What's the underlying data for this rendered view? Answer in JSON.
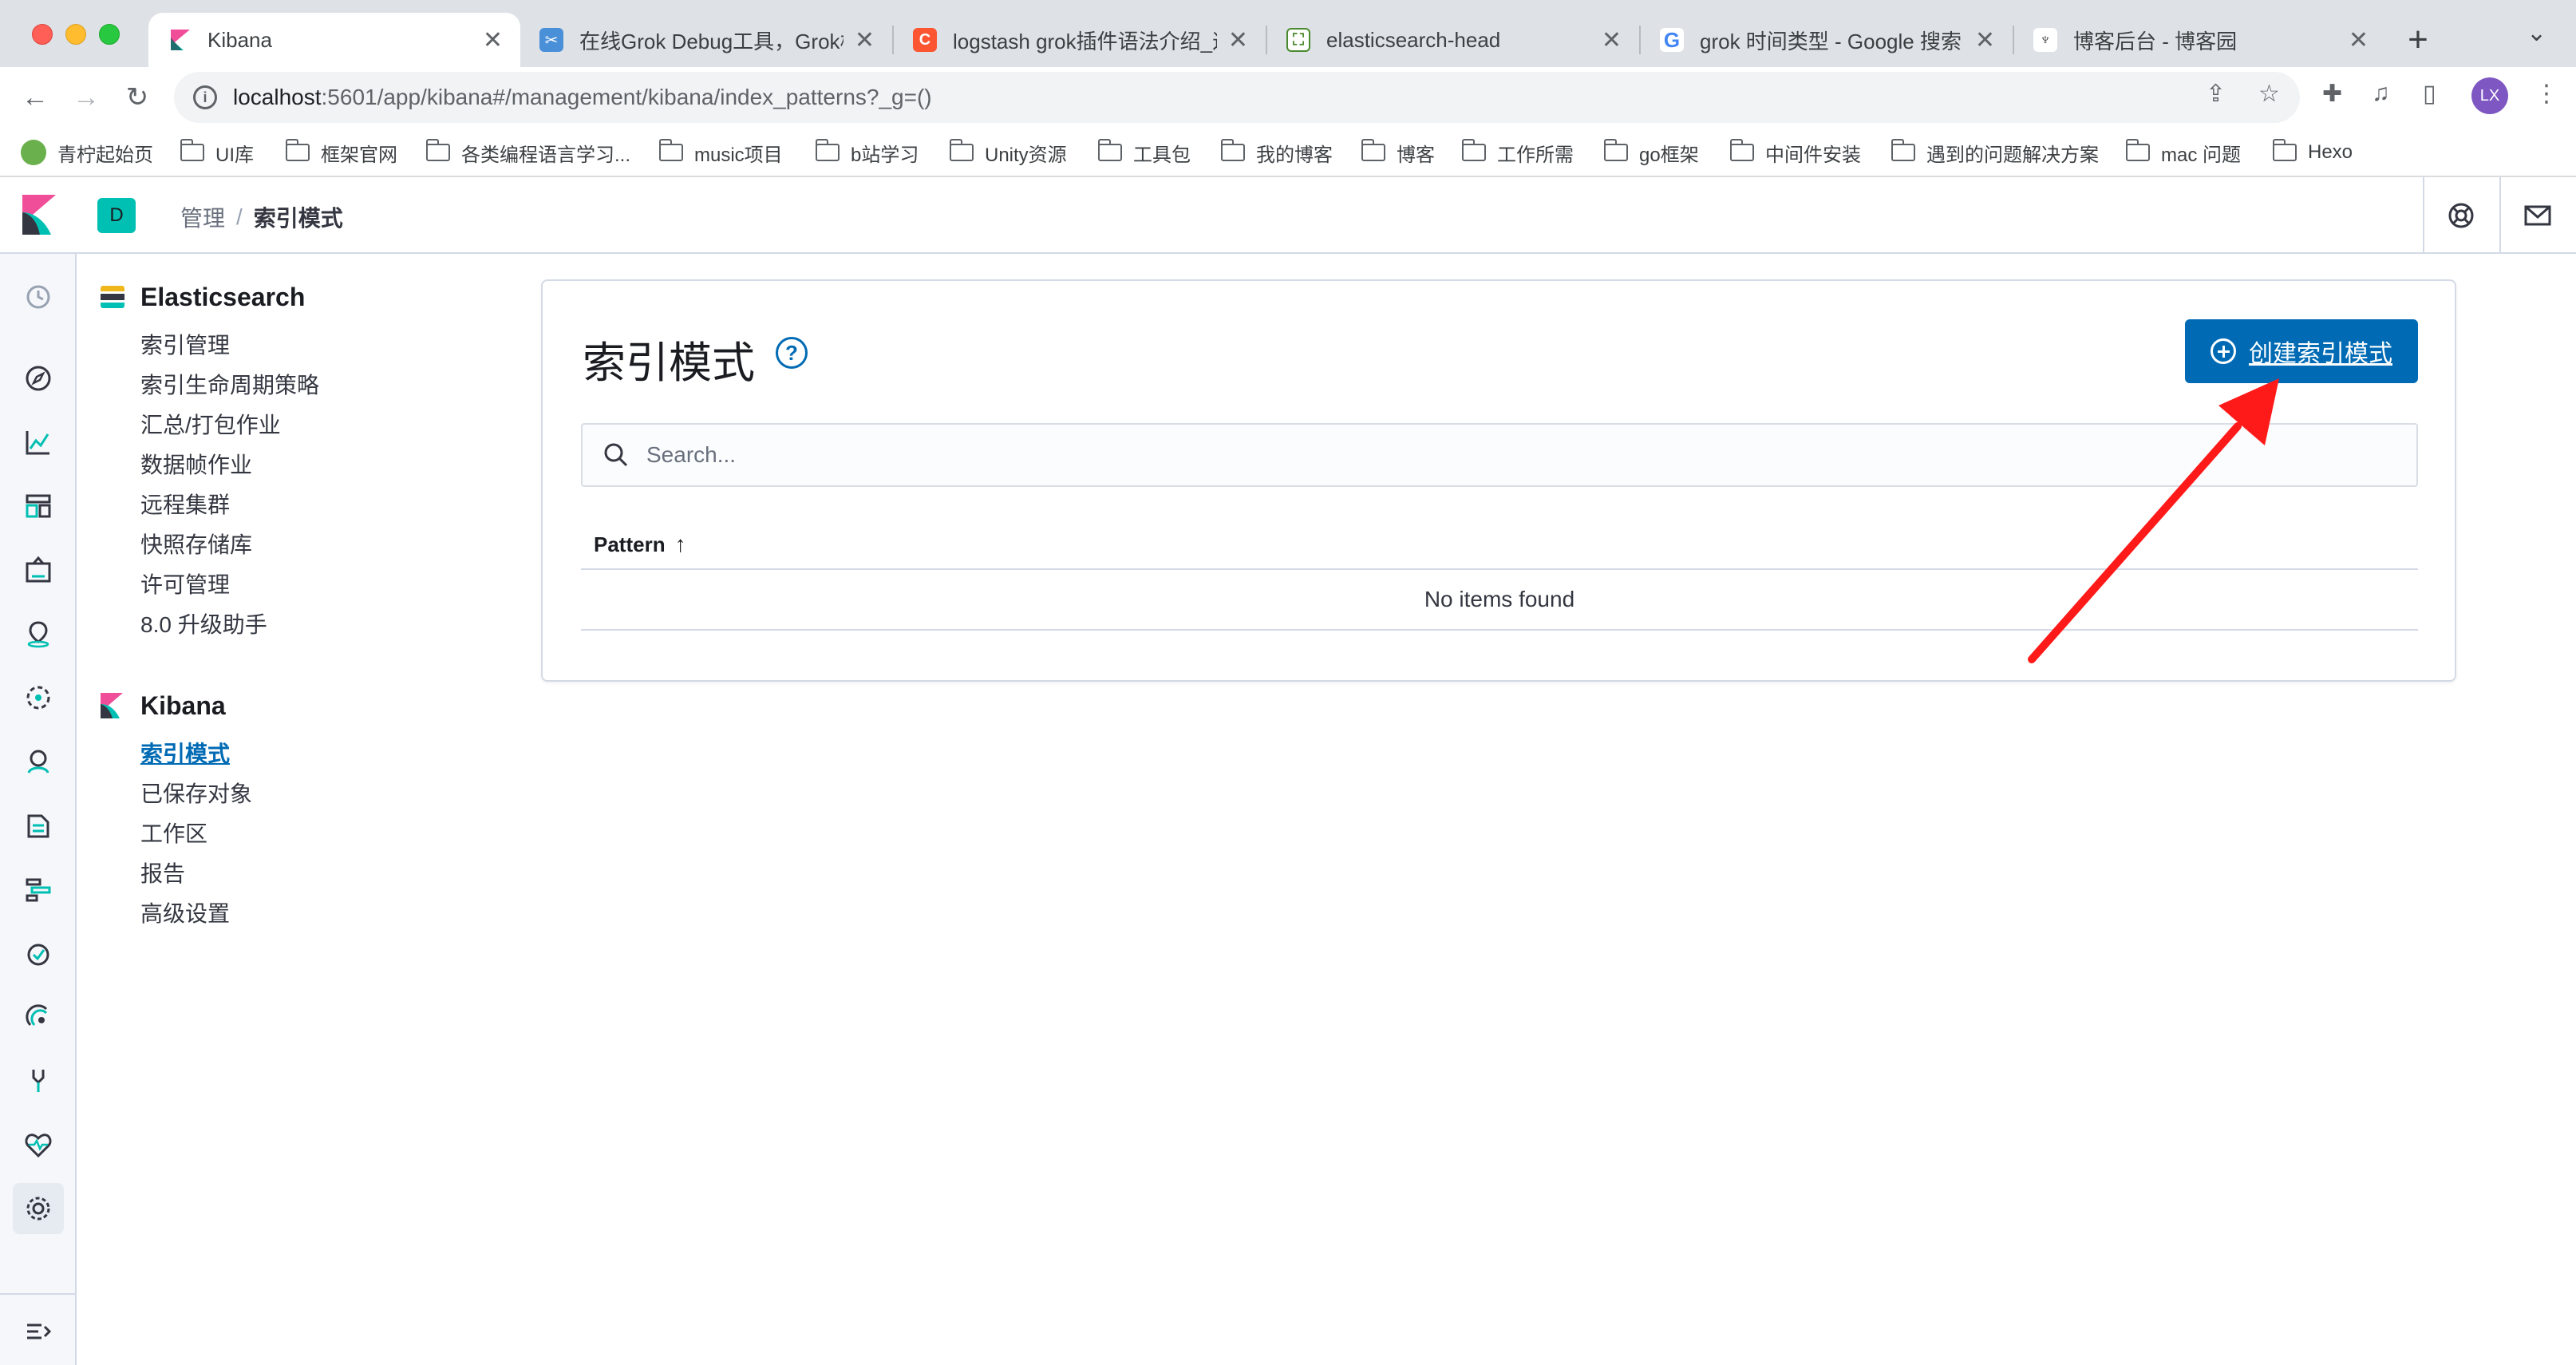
{
  "browser": {
    "tabs": [
      {
        "title": "Kibana",
        "active": true
      },
      {
        "title": "在线Grok Debug工具，Grok校验",
        "active": false
      },
      {
        "title": "logstash grok插件语法介绍_这",
        "active": false
      },
      {
        "title": "elasticsearch-head",
        "active": false
      },
      {
        "title": "grok 时间类型 - Google 搜索",
        "active": false
      },
      {
        "title": "博客后台 - 博客园",
        "active": false
      }
    ],
    "url_host": "localhost",
    "url_rest": ":5601/app/kibana#/management/kibana/index_patterns?_g=()",
    "profile_initials": "LX",
    "bookmarks": [
      "青柠起始页",
      "UI库",
      "框架官网",
      "各类编程语言学习...",
      "music项目",
      "b站学习",
      "Unity资源",
      "工具包",
      "我的博客",
      "博客",
      "工作所需",
      "go框架",
      "中间件安装",
      "遇到的问题解决方案",
      "mac 问题",
      "Hexo"
    ]
  },
  "kibana": {
    "space_initial": "D",
    "breadcrumbs": {
      "parent": "管理",
      "current": "索引模式"
    }
  },
  "sidebar": {
    "groups": [
      {
        "title": "Elasticsearch",
        "items": [
          "索引管理",
          "索引生命周期策略",
          "汇总/打包作业",
          "数据帧作业",
          "远程集群",
          "快照存储库",
          "许可管理",
          "8.0 升级助手"
        ]
      },
      {
        "title": "Kibana",
        "items": [
          "索引模式",
          "已保存对象",
          "工作区",
          "报告",
          "高级设置"
        ],
        "selected_index": 0
      }
    ]
  },
  "main": {
    "title": "索引模式",
    "create_button": "创建索引模式",
    "search_placeholder": "Search...",
    "table_header": "Pattern",
    "empty_message": "No items found"
  },
  "colors": {
    "primary": "#006bb4",
    "annotation_arrow": "#ff1a1a"
  }
}
